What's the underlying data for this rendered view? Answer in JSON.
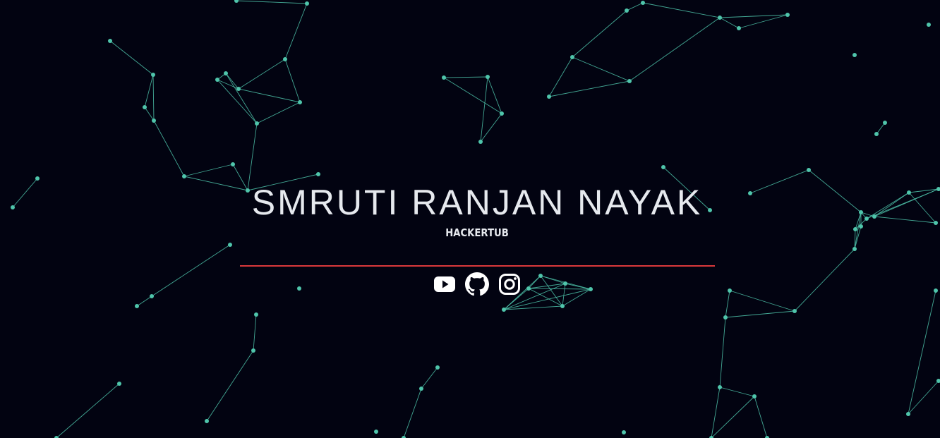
{
  "hero": {
    "name": "SMRUTI RANJAN NAYAK",
    "handle": "HACKERTUB"
  },
  "socials": [
    {
      "label": "YouTube",
      "icon": "youtube-icon"
    },
    {
      "label": "GitHub",
      "icon": "github-icon"
    },
    {
      "label": "Instagram",
      "icon": "instagram-icon"
    }
  ],
  "colors": {
    "background": "#020311",
    "particle": "#4fc5ab",
    "text": "#e6e9ee",
    "divider": "#d9383b"
  }
}
